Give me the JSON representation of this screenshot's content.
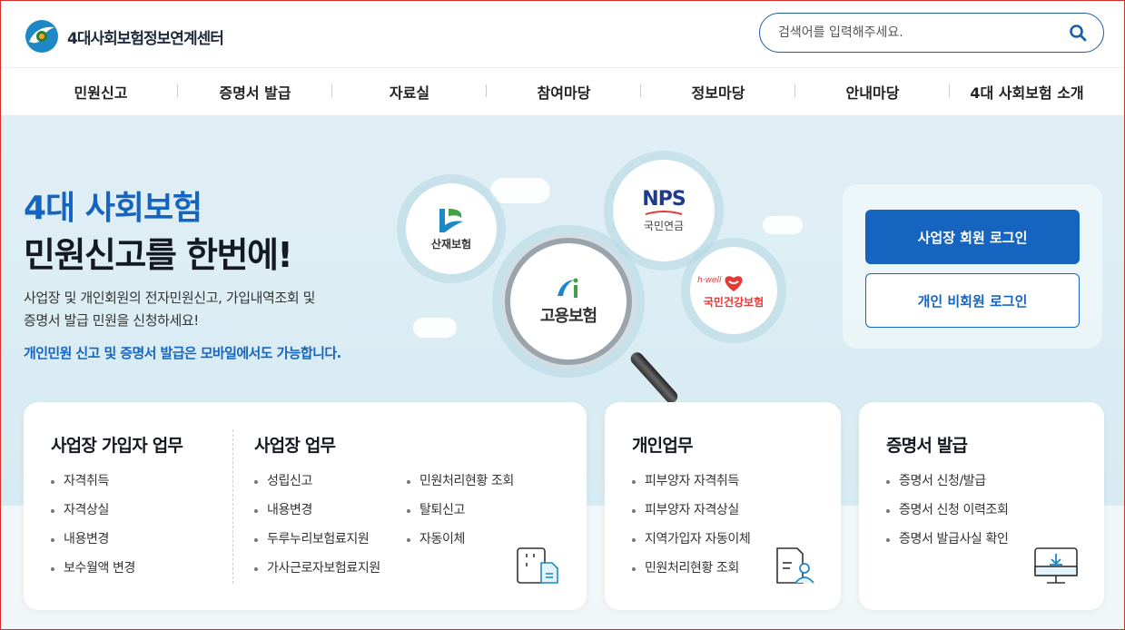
{
  "brand": {
    "name": "4대사회보험정보연계센터"
  },
  "search": {
    "placeholder": "검색어를 입력해주세요."
  },
  "nav": [
    {
      "label": "민원신고"
    },
    {
      "label": "증명서 발급"
    },
    {
      "label": "자료실"
    },
    {
      "label": "참여마당"
    },
    {
      "label": "정보마당"
    },
    {
      "label": "안내마당"
    },
    {
      "label": "4대 사회보험 소개"
    }
  ],
  "hero": {
    "title_line1": "4대 사회보험",
    "title_line2": "민원신고를 한번에!",
    "desc_line1": "사업장 및 개인회원의 전자민원신고, 가입내역조회 및",
    "desc_line2": "증명서 발급 민원을 신청하세요!",
    "note": "개인민원 신고 및 증명서 발급은 모바일에서도 가능합니다."
  },
  "insurers": {
    "sanjae": "산재보험",
    "nps_logo": "NPS",
    "nps": "국민연금",
    "goyong": "고용보험",
    "hwell_logo": "h·well",
    "health": "국민건강보험"
  },
  "login": {
    "member_label": "사업장 회원 로그인",
    "guest_label": "개인 비회원 로그인"
  },
  "cards": {
    "join": {
      "title": "사업장 가입자 업무",
      "items": [
        "자격취득",
        "자격상실",
        "내용변경",
        "보수월액 변경"
      ]
    },
    "biz": {
      "title": "사업장 업무",
      "items_left": [
        "성립신고",
        "내용변경",
        "두루누리보험료지원",
        "가사근로자보험료지원"
      ],
      "items_right": [
        "민원처리현황 조회",
        "탈퇴신고",
        "자동이체"
      ]
    },
    "personal": {
      "title": "개인업무",
      "items": [
        "피부양자 자격취득",
        "피부양자 자격상실",
        "지역가입자 자동이체",
        "민원처리현황 조회"
      ]
    },
    "cert": {
      "title": "증명서 발급",
      "items": [
        "증명서 신청/발급",
        "증명서 신청 이력조회",
        "증명서 발급사실 확인"
      ]
    }
  },
  "colors": {
    "primary": "#1565c0",
    "hero_bg": "#dcedf4",
    "text": "#151a22"
  }
}
